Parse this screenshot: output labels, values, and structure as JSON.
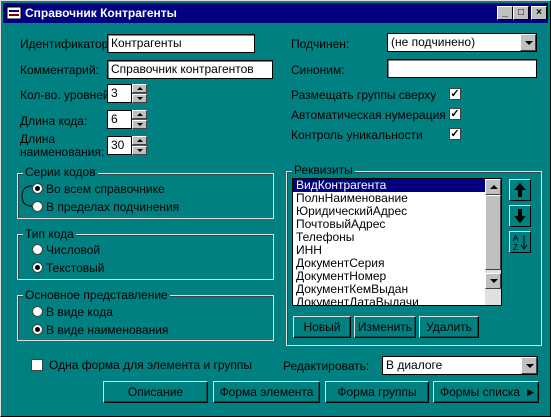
{
  "window": {
    "title": "Справочник Контрагенты",
    "controls": {
      "minimize": "_",
      "maximize": "□",
      "close": "×"
    }
  },
  "form": {
    "identifier": {
      "label": "Идентификатор:",
      "value": "Контрагенты"
    },
    "comment": {
      "label": "Комментарий:",
      "value": "Справочник контрагентов"
    },
    "levels": {
      "label": "Кол-во. уровней:",
      "value": "3"
    },
    "code_length": {
      "label": "Длина кода:",
      "value": "6"
    },
    "name_length": {
      "label_line1": "Длина",
      "label_line2": "наименования:",
      "value": "30"
    },
    "subordinate": {
      "label": "Подчинен:",
      "value": "(не подчинено)"
    },
    "synonym": {
      "label": "Синоним:",
      "value": ""
    },
    "checks": [
      {
        "label": "Размещать группы сверху",
        "checked": true
      },
      {
        "label": "Автоматическая нумерация",
        "checked": true
      },
      {
        "label": "Контроль уникальности",
        "checked": true
      }
    ]
  },
  "code_series": {
    "title": "Серии кодов",
    "options": [
      {
        "label": "Во всем справочнике",
        "selected": true
      },
      {
        "label": "В пределах подчинения",
        "selected": false
      }
    ]
  },
  "code_type": {
    "title": "Тип кода",
    "options": [
      {
        "label": "Числовой",
        "selected": false
      },
      {
        "label": "Текстовый",
        "selected": true
      }
    ]
  },
  "main_view": {
    "title": "Основное представление",
    "options": [
      {
        "label": "В виде кода",
        "selected": false
      },
      {
        "label": "В виде наименования",
        "selected": true
      }
    ]
  },
  "requisites": {
    "title": "Реквизиты",
    "items": [
      "ВидКонтрагента",
      "ПолнНаименование",
      "ЮридическийАдрес",
      "ПочтовыйАдрес",
      "Телефоны",
      "ИНН",
      "ДокументСерия",
      "ДокументНомер",
      "ДокументКемВыдан",
      "ДокументДатаВыдачи"
    ],
    "selected_index": 0,
    "buttons": {
      "new": "Новый",
      "edit": "Изменить",
      "delete": "Удалить"
    },
    "side_icons": {
      "up": "arrow-up-icon",
      "down": "arrow-down-icon",
      "sort": "sort-az-icon"
    }
  },
  "one_form": {
    "label": "Одна форма для элемента и группы",
    "checked": false
  },
  "edit_mode": {
    "label": "Редактировать:",
    "value": "В диалоге"
  },
  "bottom_buttons": {
    "description": "Описание",
    "element_form": "Форма элемента",
    "group_form": "Форма группы",
    "list_forms": "Формы списка"
  }
}
